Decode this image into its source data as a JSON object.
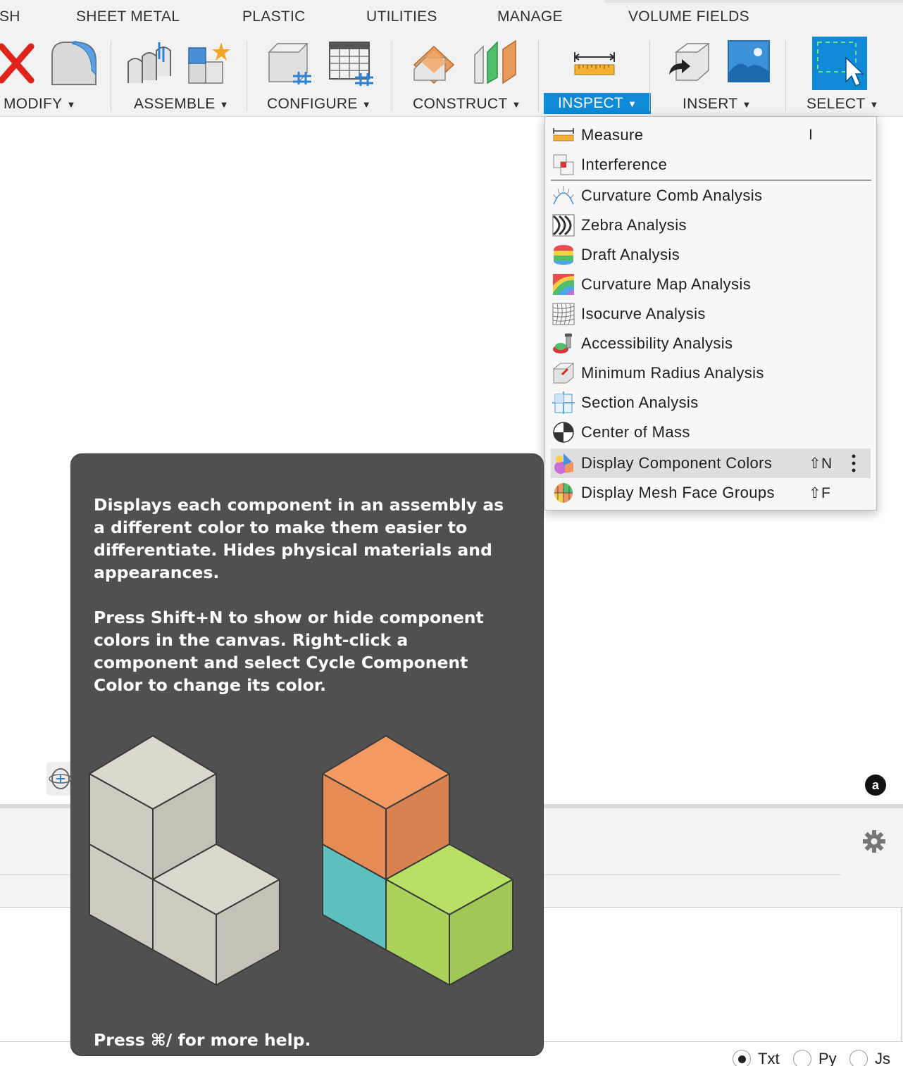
{
  "tabs": [
    "SH",
    "SHEET METAL",
    "PLASTIC",
    "UTILITIES",
    "MANAGE",
    "VOLUME FIELDS"
  ],
  "toolbar": {
    "groups": [
      "MODIFY",
      "ASSEMBLE",
      "CONFIGURE",
      "CONSTRUCT",
      "INSPECT",
      "INSERT",
      "SELECT"
    ],
    "active_group": "INSPECT",
    "accent_color": "#0e8ad6"
  },
  "inspect_menu": {
    "items": [
      {
        "label": "Measure",
        "shortcut": "I",
        "icon": "ruler-icon"
      },
      {
        "label": "Interference",
        "shortcut": "",
        "icon": "interference-icon"
      },
      {
        "label": "Curvature Comb Analysis",
        "shortcut": "",
        "icon": "curvature-comb-icon"
      },
      {
        "label": "Zebra Analysis",
        "shortcut": "",
        "icon": "zebra-icon"
      },
      {
        "label": "Draft Analysis",
        "shortcut": "",
        "icon": "draft-icon"
      },
      {
        "label": "Curvature Map Analysis",
        "shortcut": "",
        "icon": "curvature-map-icon"
      },
      {
        "label": "Isocurve Analysis",
        "shortcut": "",
        "icon": "isocurve-icon"
      },
      {
        "label": "Accessibility Analysis",
        "shortcut": "",
        "icon": "accessibility-icon"
      },
      {
        "label": "Minimum Radius Analysis",
        "shortcut": "",
        "icon": "minimum-radius-icon"
      },
      {
        "label": "Section Analysis",
        "shortcut": "",
        "icon": "section-icon"
      },
      {
        "label": "Center of Mass",
        "shortcut": "",
        "icon": "center-of-mass-icon"
      },
      {
        "label": "Display Component Colors",
        "shortcut": "⇧N",
        "icon": "component-colors-icon"
      },
      {
        "label": "Display Mesh Face Groups",
        "shortcut": "⇧F",
        "icon": "mesh-face-groups-icon"
      }
    ],
    "highlighted": "Display Component Colors"
  },
  "tooltip": {
    "paragraph1": "Displays each component in an assembly as a different color to make them easier to differentiate. Hides physical materials and appearances.",
    "paragraph2": "Press Shift+N to show or hide component colors in the canvas. Right-click a component and select Cycle Component Color to change its color.",
    "footer": "Press ⌘/ for more help.",
    "cube_colors": {
      "neutral": "#d6d2c8",
      "orange": "#f0955f",
      "teal": "#5cc0bd",
      "green": "#b3dd5f"
    }
  },
  "bottom_panel": {
    "radio_options": [
      "Txt",
      "Py",
      "Js"
    ],
    "selected_radio": "Txt"
  }
}
